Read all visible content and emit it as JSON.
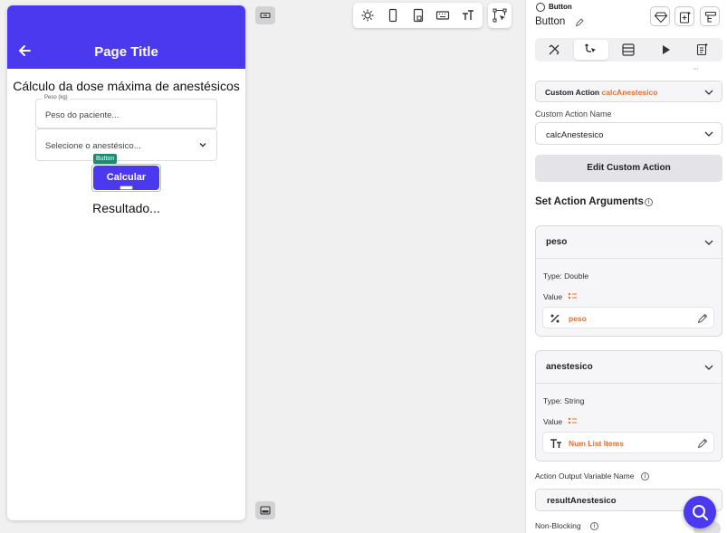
{
  "preview": {
    "appbar_title": "Page Title",
    "heading": "Cálculo da dose máxima de anestésicos",
    "peso_label": "Peso (kg)",
    "peso_placeholder": "Peso do paciente...",
    "select_placeholder": "Selecione o anestésico...",
    "selected_badge": "Button",
    "button_label": "Calcular",
    "result_text": "Resultado..."
  },
  "panel": {
    "widget_type": "Button",
    "widget_name": "Button",
    "custom_action_prefix": "Custom Action",
    "custom_action_value": "calcAnestesico",
    "custom_action_name_label": "Custom Action Name",
    "custom_action_name_value": "calcAnestesico",
    "edit_button": "Edit Custom Action",
    "arguments_title": "Set Action Arguments",
    "args": [
      {
        "name": "peso",
        "type": "Type: Double",
        "value_label": "Value",
        "value_icon": "variable-icon",
        "value": "peso"
      },
      {
        "name": "anestesico",
        "type": "Type: String",
        "value_label": "Value",
        "value_icon": "text-icon",
        "value": "Num List Items"
      }
    ],
    "output_label": "Action Output Variable Name",
    "output_value": "resultAnestesico",
    "nonblocking_label": "Non-Blocking"
  },
  "colors": {
    "primary": "#4b39ef",
    "accent": "#ef6c2c",
    "badge": "#1f8a6f"
  }
}
